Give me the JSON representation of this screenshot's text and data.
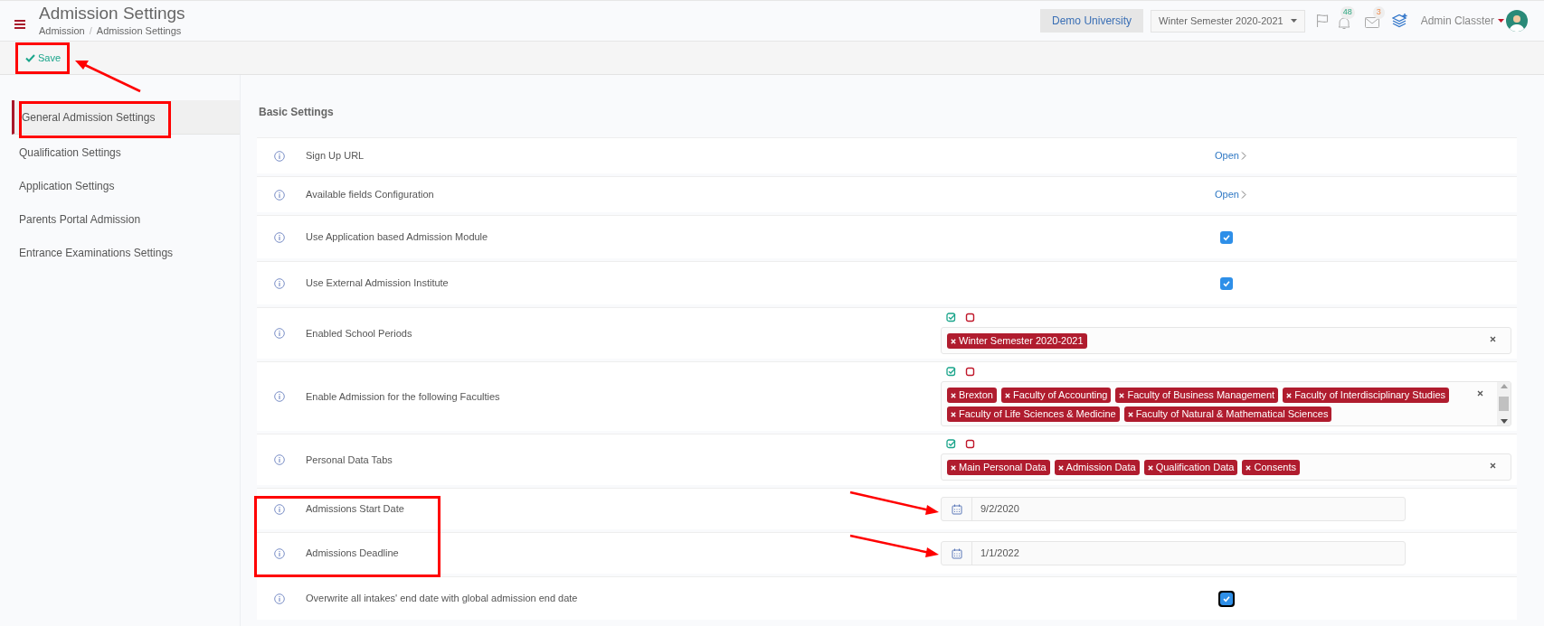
{
  "header": {
    "title": "Admission Settings",
    "breadcrumb": [
      "Admission",
      "Admission Settings"
    ],
    "separator": "/",
    "institution": "Demo University",
    "period": "Winter Semester 2020-2021",
    "notifications": "48",
    "messages": "3",
    "user": "Admin Classter"
  },
  "toolbar": {
    "save": "Save"
  },
  "sidebar": {
    "items": [
      {
        "label": "General Admission Settings",
        "selected": true
      },
      {
        "label": "Qualification Settings",
        "selected": false
      },
      {
        "label": "Application Settings",
        "selected": false
      },
      {
        "label": "Parents Portal Admission",
        "selected": false
      },
      {
        "label": "Entrance Examinations Settings",
        "selected": false
      }
    ]
  },
  "section": {
    "title": "Basic Settings",
    "rows": [
      {
        "kind": "link",
        "label": "Sign Up URL",
        "link": "Open"
      },
      {
        "kind": "link",
        "label": "Available fields Configuration",
        "link": "Open"
      },
      {
        "kind": "checkbox",
        "label": "Use Application based Admission Module",
        "checked": true,
        "focused": false
      },
      {
        "kind": "checkbox",
        "label": "Use External Admission Institute",
        "checked": true,
        "focused": false
      },
      {
        "kind": "tags",
        "label": "Enabled School Periods",
        "tags": [
          "Winter Semester 2020-2021"
        ],
        "scroll": false
      },
      {
        "kind": "tags",
        "label": "Enable Admission for the following Faculties",
        "tags": [
          "Brexton",
          "Faculty of Accounting",
          "Faculty of Business Management",
          "Faculty of Interdisciplinary Studies",
          "Faculty of Life Sciences & Medicine",
          "Faculty of Natural & Mathematical Sciences"
        ],
        "scroll": true
      },
      {
        "kind": "tags",
        "label": "Personal Data Tabs",
        "tags": [
          "Main Personal Data",
          "Admission Data",
          "Qualification Data",
          "Consents"
        ],
        "scroll": false
      },
      {
        "kind": "date",
        "label": "Admissions Start Date",
        "value": "9/2/2020"
      },
      {
        "kind": "date",
        "label": "Admissions Deadline",
        "value": "1/1/2022"
      },
      {
        "kind": "checkbox",
        "label": "Overwrite all intakes' end date with global admission end date",
        "checked": true,
        "focused": true
      }
    ]
  }
}
